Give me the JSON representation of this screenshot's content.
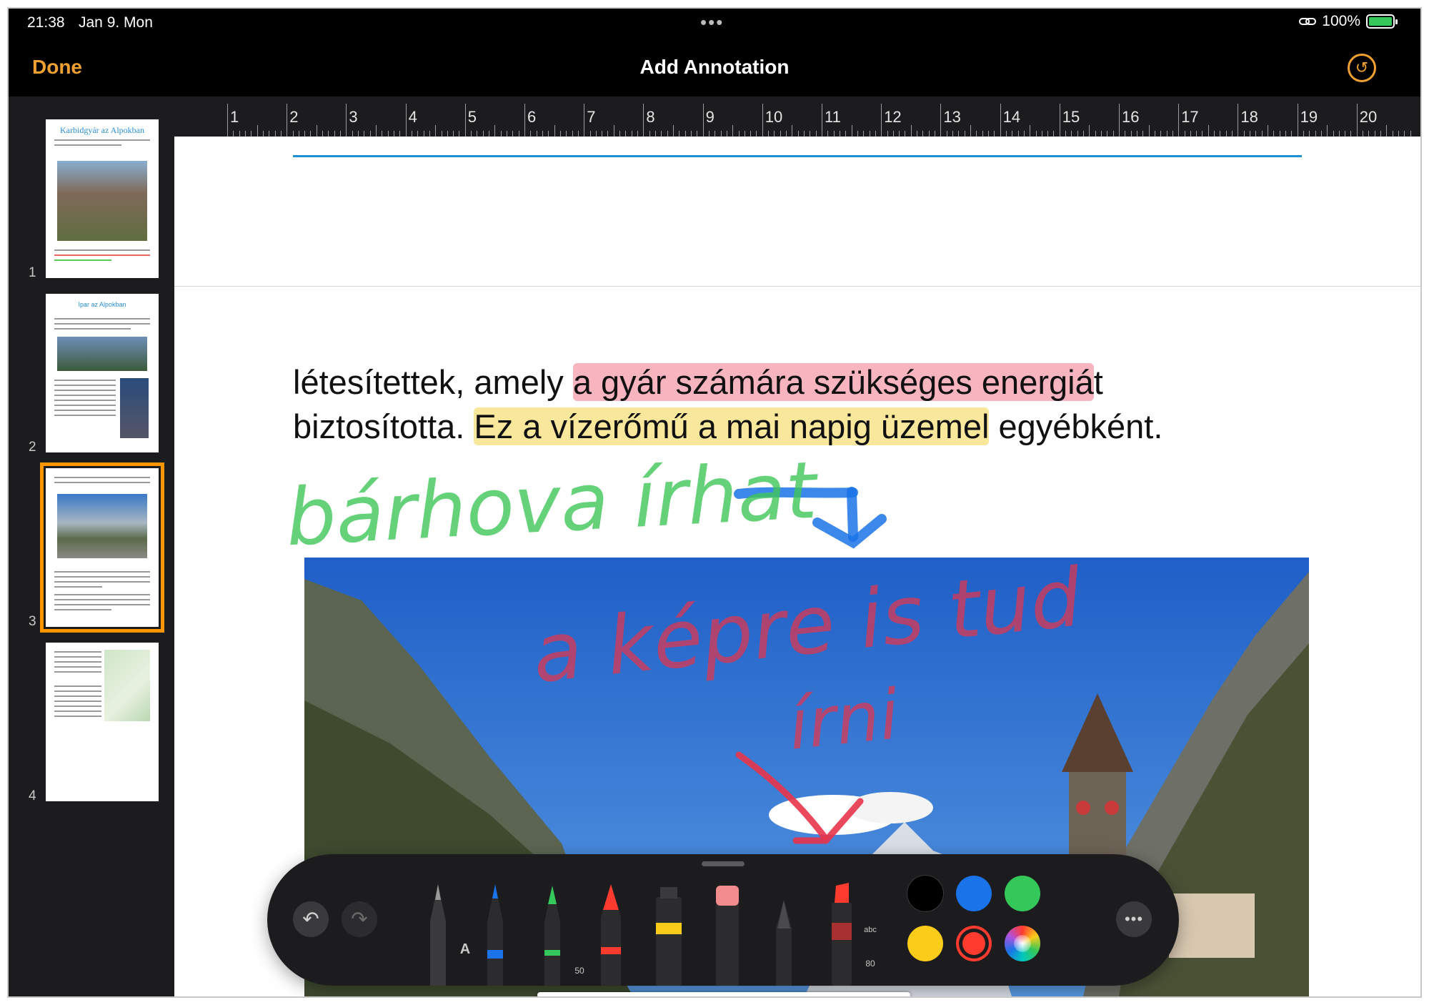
{
  "status_bar": {
    "time": "21:38",
    "date": "Jan 9. Mon",
    "more": "•••",
    "battery": "100%"
  },
  "nav": {
    "done_label": "Done",
    "title": "Add Annotation",
    "revert_icon": "revert-icon"
  },
  "sidebar": {
    "pages": [
      {
        "number": "1",
        "title": "Karbidgyár az Alpokban"
      },
      {
        "number": "2",
        "title": "Ipar az Alpokban"
      },
      {
        "number": "3",
        "title": ""
      },
      {
        "number": "4",
        "title": ""
      }
    ],
    "selected_page": "3"
  },
  "ruler": {
    "labels": [
      "1",
      "2",
      "3",
      "4",
      "5",
      "6",
      "7",
      "8",
      "9",
      "10",
      "11",
      "12",
      "13",
      "14",
      "15",
      "16",
      "17",
      "18",
      "19",
      "20"
    ]
  },
  "document": {
    "line1_a": "létesítettek, amely ",
    "line1_hl": "a gyár számára szükséges energiá",
    "line1_b": "t",
    "line2_a": "biztosította. ",
    "line2_hl": "Ez a vízerőmű a mai napig üzemel",
    "line2_b": " egyébként."
  },
  "annotations": {
    "green_handwriting": "bárhova írhat",
    "red_handwriting_line1": "a képre is tud",
    "red_handwriting_line2": "írni"
  },
  "toolbar": {
    "undo_icon": "undo-icon",
    "redo_icon": "redo-icon",
    "tools": [
      {
        "name": "text-pen",
        "label": "A"
      },
      {
        "name": "pen",
        "label": ""
      },
      {
        "name": "marker",
        "label": "50"
      },
      {
        "name": "crayon",
        "label": ""
      },
      {
        "name": "highlighter",
        "label": ""
      },
      {
        "name": "eraser",
        "label": ""
      },
      {
        "name": "pencil",
        "label": ""
      },
      {
        "name": "fill-marker",
        "label": "80",
        "tag": "abc"
      }
    ],
    "colors": [
      "#000000",
      "#1a73e8",
      "#34c759",
      "#fccc1a",
      "#ff3b30",
      "spectrum"
    ],
    "selected_color": "#ff3b30",
    "more_icon": "more-icon"
  }
}
